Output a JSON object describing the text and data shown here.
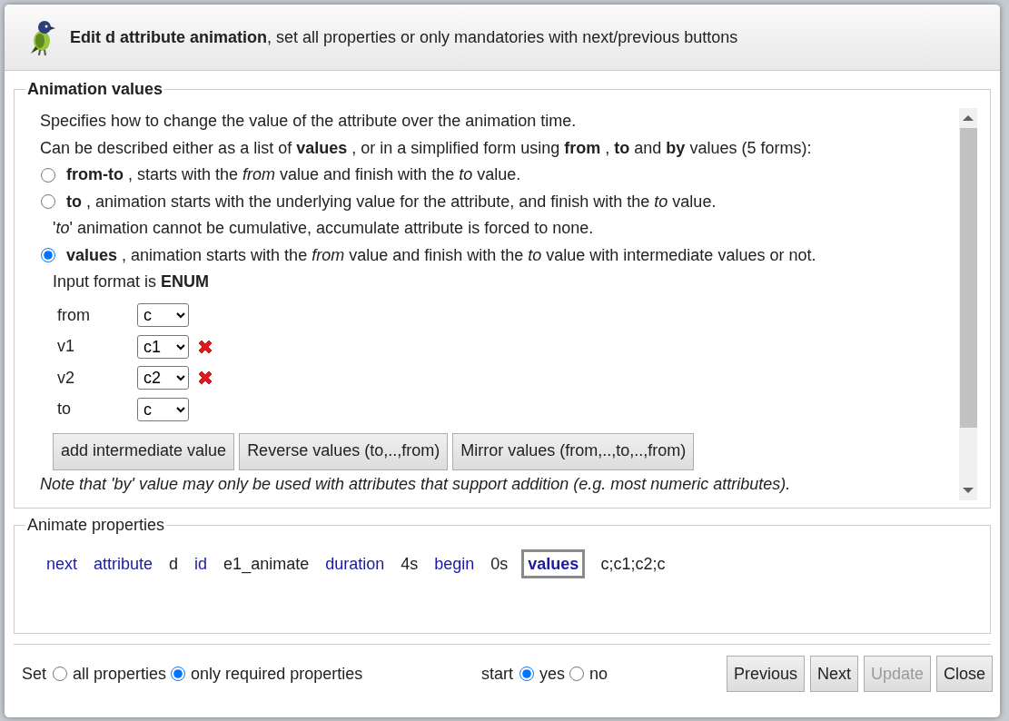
{
  "dialog": {
    "title": "**Edit d attribute animation**, set all properties or only mandatories with next/previous buttons"
  },
  "animation_values": {
    "legend": "Animation values",
    "lines": [
      "Specifies how to change the value of the attribute over the animation time.",
      "Can be described either as a list of **values** , or in a simplified form using **from** , **to** and **by** values (5 forms):"
    ],
    "options": [
      {
        "label": "**from-to** , starts with the *from* value and finish with the *to* value.",
        "selected": false
      },
      {
        "label": "**to** , animation starts with the underlying value for the attribute, and finish with the *to* value.",
        "selected": false,
        "note": "'*to*' animation cannot be cumulative, accumulate attribute is forced to none."
      },
      {
        "label": "**values** , animation starts with the *from* value and finish with the *to* value with intermediate values or not.",
        "selected": true
      }
    ],
    "input_format": "Input format is **ENUM**",
    "values": [
      {
        "label": "from",
        "value": "c",
        "removable": false
      },
      {
        "label": "v1",
        "value": "c1",
        "removable": true
      },
      {
        "label": "v2",
        "value": "c2",
        "removable": true
      },
      {
        "label": "to",
        "value": "c",
        "removable": false
      }
    ],
    "buttons": [
      "add intermediate value",
      "Reverse values (to,..,from)",
      "Mirror values (from,..,to,..,from)"
    ],
    "note": "Note that 'by' value may only be used with attributes that support addition (e.g. most numeric attributes)."
  },
  "animate_properties": {
    "legend": "Animate properties",
    "items": [
      {
        "kind": "key",
        "text": "next",
        "selected": false
      },
      {
        "kind": "key",
        "text": "attribute",
        "selected": false
      },
      {
        "kind": "value",
        "text": "d"
      },
      {
        "kind": "key",
        "text": "id",
        "selected": false
      },
      {
        "kind": "value",
        "text": "e1_animate"
      },
      {
        "kind": "key",
        "text": "duration",
        "selected": false
      },
      {
        "kind": "value",
        "text": "4s"
      },
      {
        "kind": "key",
        "text": "begin",
        "selected": false
      },
      {
        "kind": "value",
        "text": "0s"
      },
      {
        "kind": "key",
        "text": "values",
        "selected": true
      },
      {
        "kind": "value",
        "text": "c;c1;c2;c"
      }
    ]
  },
  "footer": {
    "set_label": "Set",
    "set_options": [
      {
        "label": "all properties",
        "selected": false
      },
      {
        "label": "only required properties",
        "selected": true
      }
    ],
    "start_label": "start",
    "start_options": [
      {
        "label": "yes",
        "selected": true
      },
      {
        "label": "no",
        "selected": false
      }
    ],
    "buttons": [
      {
        "label": "Previous",
        "disabled": false
      },
      {
        "label": "Next",
        "disabled": false
      },
      {
        "label": "Update",
        "disabled": true
      },
      {
        "label": "Close",
        "disabled": false
      }
    ]
  }
}
